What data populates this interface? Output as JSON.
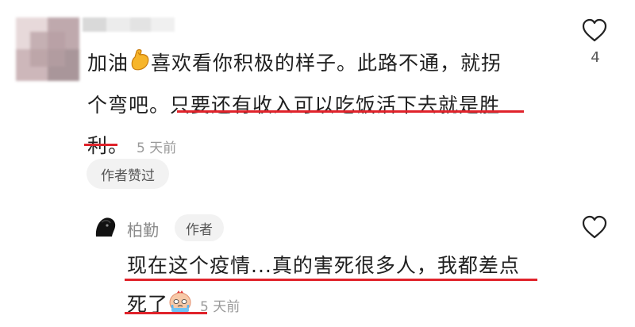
{
  "comment": {
    "text_line1": "加油",
    "text_line1b": "喜欢看你积极的样子。此路不通，就拐",
    "text_line2a": "个弯吧。",
    "text_line2b": "只要还有收入可以吃饭活下去就是胜",
    "text_line3": "利",
    "text_line3_punct": "。",
    "time": "5 天前",
    "author_liked": "作者赞过",
    "like_count": "4"
  },
  "reply": {
    "username": "柏勤",
    "badge": "作者",
    "text_line1": "现在这个疫情...真的害死很多人，我都差点",
    "text_line2": "死了",
    "time": "5 天前"
  },
  "colors": {
    "underline": "#e0232b",
    "pill_bg": "#f2f2f2",
    "muted_text": "#9a9a9a"
  },
  "icons": [
    "flexed-biceps-emoji",
    "heart-outline-icon",
    "crying-emoji"
  ]
}
